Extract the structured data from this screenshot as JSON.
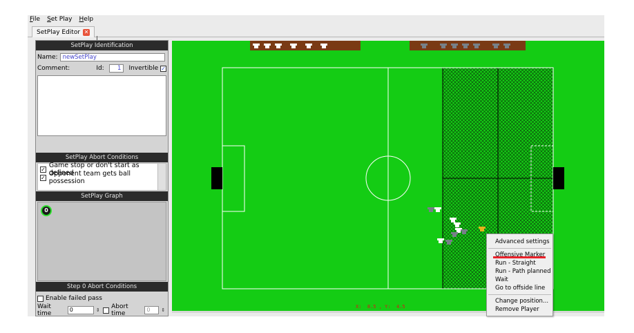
{
  "menu": {
    "file": "File",
    "setplay": "Set Play",
    "help": "Help"
  },
  "tab": {
    "label": "SetPlay Editor"
  },
  "identification": {
    "title": "SetPlay Identification",
    "name_label": "Name:",
    "name_value": "newSetPlay",
    "comment_label": "Comment:",
    "id_label": "Id:",
    "id_value": "1",
    "invertible_label": "Invertible"
  },
  "abort_conditions": {
    "title": "SetPlay Abort Conditions",
    "items": [
      "Game stop or don't start as defined",
      "Opponent team gets ball possession"
    ]
  },
  "graph": {
    "title": "SetPlay Graph",
    "node_label": "0"
  },
  "step_abort": {
    "title": "Step 0 Abort Conditions",
    "failed_pass_label": "Enable failed pass",
    "wait_time_label": "Wait time",
    "wait_time_value": "0",
    "abort_time_label": "Abort time",
    "abort_time_value": "0"
  },
  "coords": {
    "text": "X:  8.5 , Y:  4.5"
  },
  "context_menu": {
    "items": [
      "Advanced settings",
      "Offensive Marker",
      "Run - Straight",
      "Run - Path planned",
      "Wait",
      "Go to offside line",
      "Change position...",
      "Remove Player"
    ]
  },
  "colors": {
    "field": "#14cc14",
    "bench": "#7a3a14",
    "highlight": "#e8212a"
  }
}
